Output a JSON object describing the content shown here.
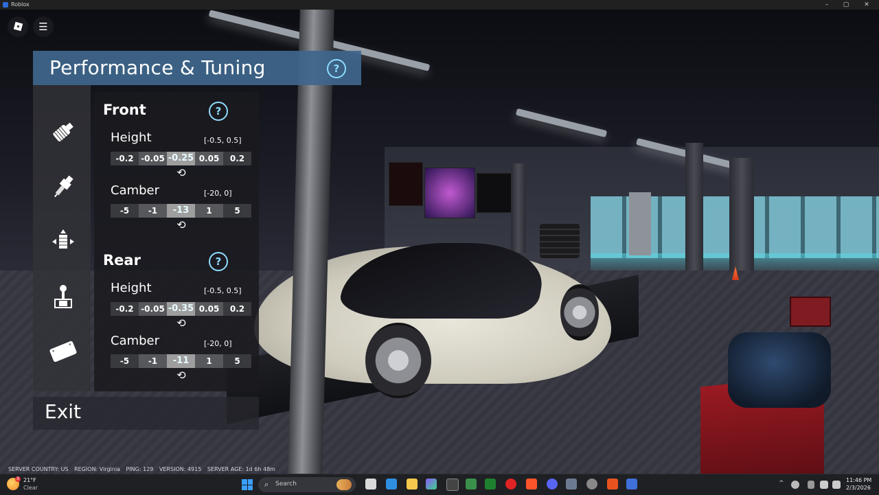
{
  "window": {
    "title": "Roblox",
    "minimize": "–",
    "maximize": "▢",
    "close": "✕"
  },
  "topbar": {
    "menu_glyph": "☰"
  },
  "panel": {
    "title": "Performance & Tuning",
    "help_glyph": "?",
    "side_icons": [
      "air-filter-icon",
      "spark-plug-icon",
      "suspension-icon",
      "gearshift-icon",
      "license-plate-icon"
    ],
    "front": {
      "title": "Front",
      "height": {
        "label": "Height",
        "range": "[-0.5, 0.5]",
        "buttons": [
          "-0.2",
          "-0.05",
          "-0.25",
          "0.05",
          "0.2"
        ]
      },
      "camber": {
        "label": "Camber",
        "range": "[-20, 0]",
        "buttons": [
          "-5",
          "-1",
          "-13",
          "1",
          "5"
        ]
      }
    },
    "rear": {
      "title": "Rear",
      "height": {
        "label": "Height",
        "range": "[-0.5, 0.5]",
        "buttons": [
          "-0.2",
          "-0.05",
          "-0.35",
          "0.05",
          "0.2"
        ]
      },
      "camber": {
        "label": "Camber",
        "range": "[-20, 0]",
        "buttons": [
          "-5",
          "-1",
          "-11",
          "1",
          "5"
        ]
      }
    },
    "reset_glyph": "⟲",
    "exit": "Exit"
  },
  "server_info": {
    "country": "SERVER COUNTRY: US",
    "region": "REGION: Virginia",
    "ping": "PING: 129",
    "version": "VERSION: 4915",
    "age": "SERVER AGE: 1d 6h 48m"
  },
  "taskbar": {
    "weather_temp": "21°F",
    "weather_cond": "Clear",
    "weather_badge": "3",
    "search_placeholder": "Search",
    "search_glyph": "⌕",
    "tray_chevron": "^",
    "time": "11:46 PM",
    "date": "2/3/2026"
  },
  "colors": {
    "header_bg": "#3e668c",
    "help_accent": "#8fdcff",
    "value_highlight": "#e8fbff"
  }
}
